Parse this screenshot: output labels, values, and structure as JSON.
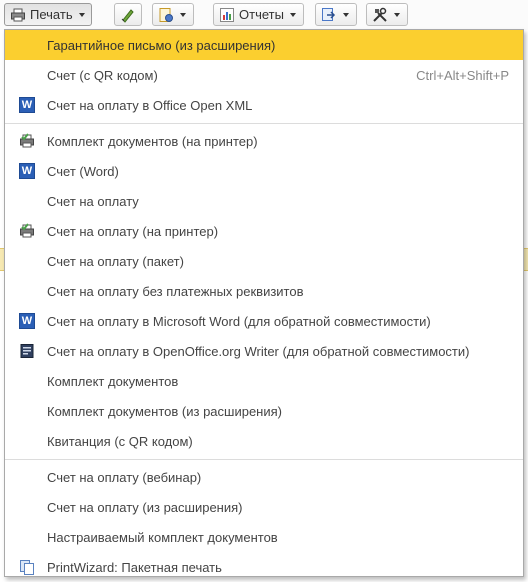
{
  "toolbar": {
    "print_label": "Печать",
    "reports_label": "Отчеты"
  },
  "menu": {
    "items": [
      {
        "label": "Гарантийное письмо (из расширения)",
        "icon": "",
        "highlight": true
      },
      {
        "label": "Счет (с QR кодом)",
        "shortcut": "Ctrl+Alt+Shift+P",
        "icon": ""
      },
      {
        "label": "Счет на оплату в Office Open XML",
        "icon": "word-icon"
      },
      {
        "label": "Комплект документов (на принтер)",
        "icon": "printer-icon"
      },
      {
        "label": "Счет (Word)",
        "icon": "word-icon"
      },
      {
        "label": "Счет на оплату",
        "icon": ""
      },
      {
        "label": "Счет на оплату (на принтер)",
        "icon": "printer-icon"
      },
      {
        "label": "Счет на оплату (пакет)",
        "icon": ""
      },
      {
        "label": "Счет на оплату без платежных реквизитов",
        "icon": ""
      },
      {
        "label": "Счет на оплату в Microsoft Word (для обратной совместимости)",
        "icon": "word-icon"
      },
      {
        "label": "Счет на оплату в OpenOffice.org Writer (для обратной совместимости)",
        "icon": "writer-icon"
      },
      {
        "label": "Комплект документов",
        "icon": ""
      },
      {
        "label": "Комплект документов (из расширения)",
        "icon": ""
      },
      {
        "label": "Квитанция (с QR кодом)",
        "icon": ""
      },
      {
        "label": "Счет на оплату (вебинар)",
        "icon": ""
      },
      {
        "label": "Счет на оплату (из расширения)",
        "icon": ""
      },
      {
        "label": "Настраиваемый комплект документов",
        "icon": ""
      },
      {
        "label": "PrintWizard: Пакетная печать",
        "icon": "documents-icon"
      }
    ],
    "word_icon_letter": "W"
  },
  "colors": {
    "highlight": "#fbcf2f",
    "word_blue": "#2b5fb6"
  }
}
